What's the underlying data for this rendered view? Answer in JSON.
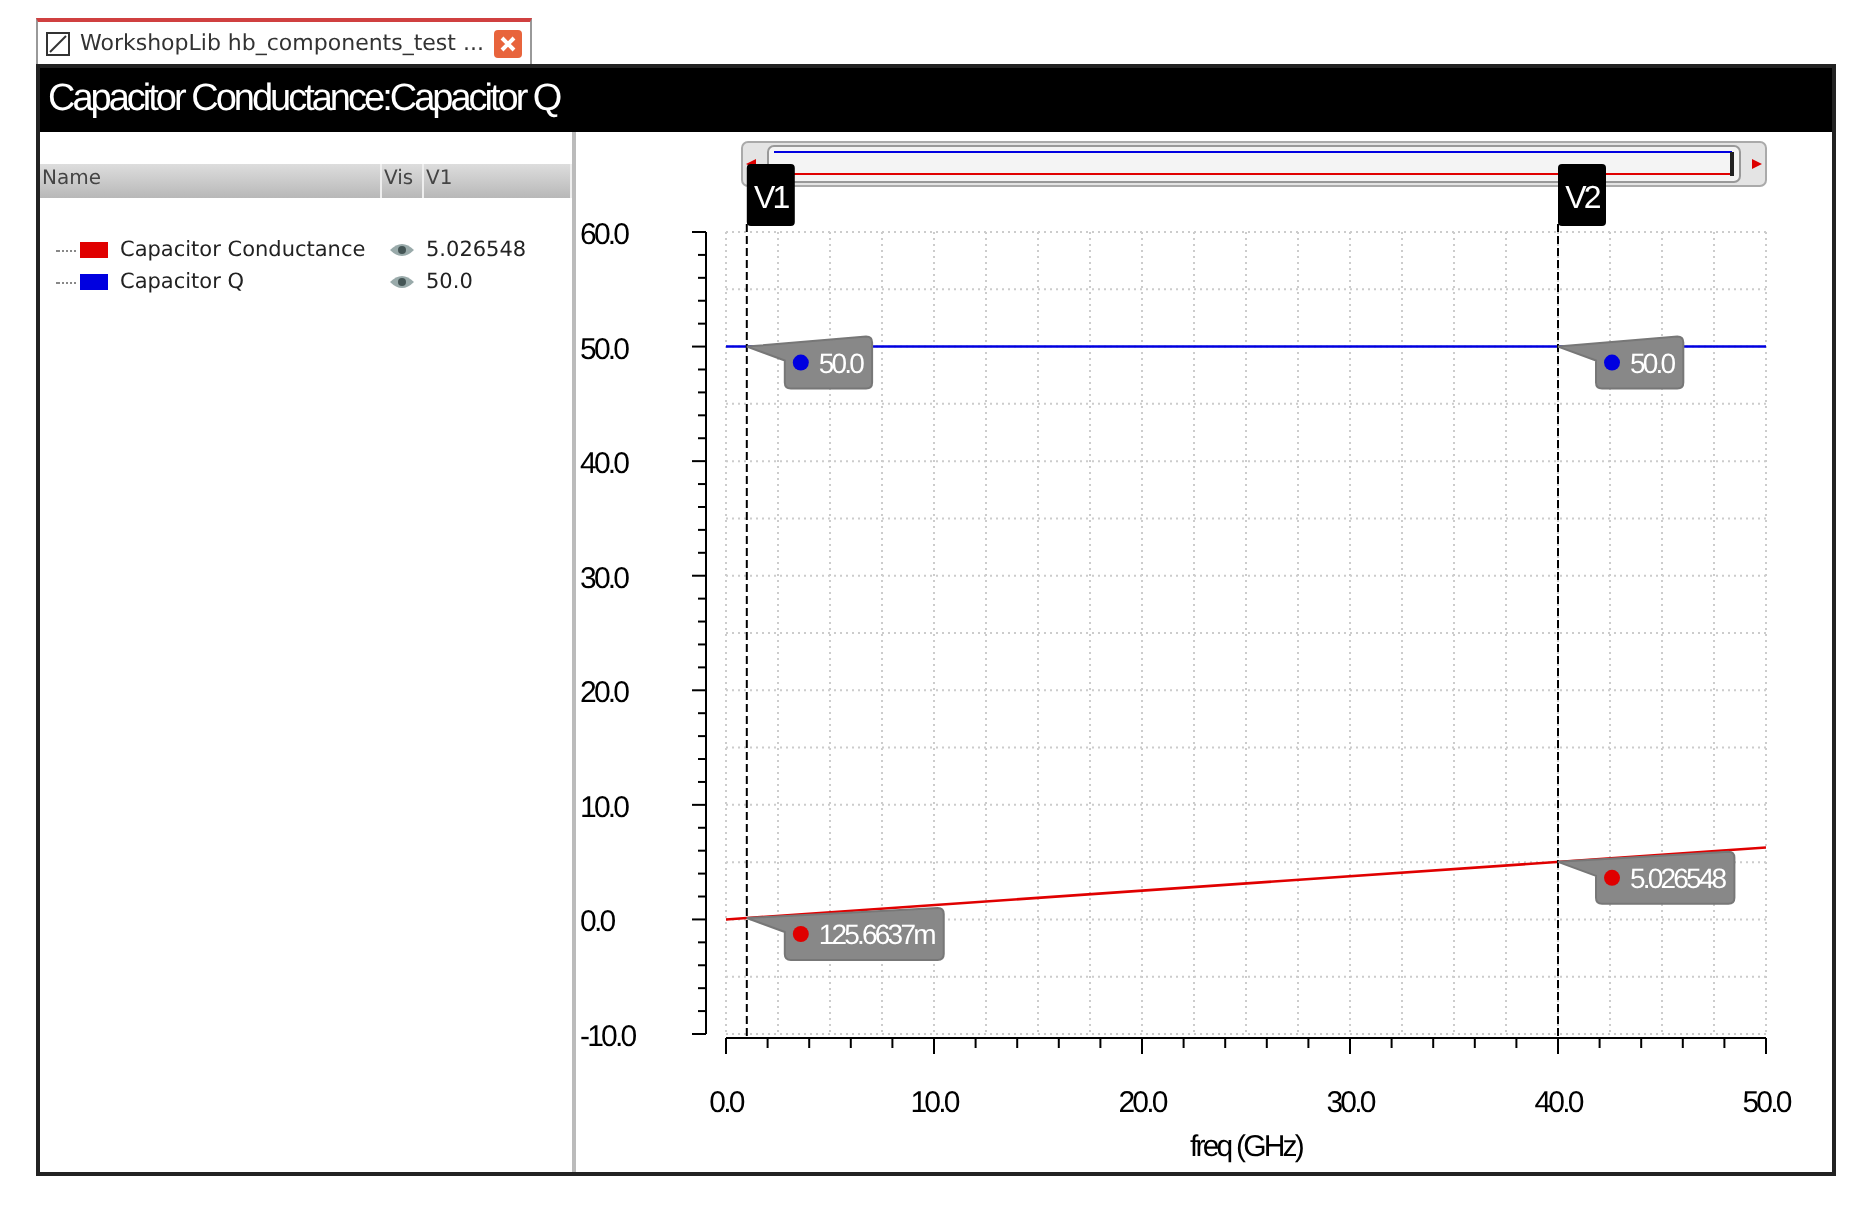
{
  "tab": {
    "title": "WorkshopLib hb_components_test ...",
    "selected": true
  },
  "plot_title": "Capacitor Conductance:Capacitor Q",
  "legend": {
    "columns": [
      "Name",
      "Vis",
      "V1"
    ],
    "rows": [
      {
        "visible": true,
        "value": "5.026548"
      },
      {
        "visible": true,
        "value": "50.0"
      }
    ]
  },
  "chart": {
    "chart_data": {
      "type": "line",
      "xlabel": "freq (GHz)",
      "x": [
        0,
        50
      ],
      "series": [
        {
          "name": "Capacitor Conductance",
          "color": "#e00000",
          "values": [
            0,
            6.28
          ]
        },
        {
          "name": "Capacitor Q",
          "color": "#0000e0",
          "values": [
            50,
            50
          ]
        }
      ],
      "xlim": [
        0,
        50
      ],
      "ylim": [
        -10,
        60
      ],
      "grid": true,
      "xticks": [
        {
          "value": 0,
          "label": "0.0"
        },
        {
          "value": 10,
          "label": "10.0"
        },
        {
          "value": 20,
          "label": "20.0"
        },
        {
          "value": 30,
          "label": "30.0"
        },
        {
          "value": 40,
          "label": "40.0"
        },
        {
          "value": 50,
          "label": "50.0"
        }
      ],
      "yticks": [
        {
          "value": -10,
          "label": "-10.0"
        },
        {
          "value": 0,
          "label": "0.0"
        },
        {
          "value": 10,
          "label": "10.0"
        },
        {
          "value": 20,
          "label": "20.0"
        },
        {
          "value": 30,
          "label": "30.0"
        },
        {
          "value": 40,
          "label": "40.0"
        },
        {
          "value": 50,
          "label": "50.0"
        },
        {
          "value": 60,
          "label": "60.0"
        }
      ],
      "ref_lines": [
        {
          "axis": "x",
          "value": 1,
          "label": "V1"
        },
        {
          "axis": "x",
          "value": 40,
          "label": "V2"
        }
      ]
    },
    "cursor_readouts": [
      {
        "values": [
          "50.0",
          "125.6637m"
        ]
      },
      {
        "values": [
          "50.0",
          "5.026548"
        ]
      }
    ]
  }
}
